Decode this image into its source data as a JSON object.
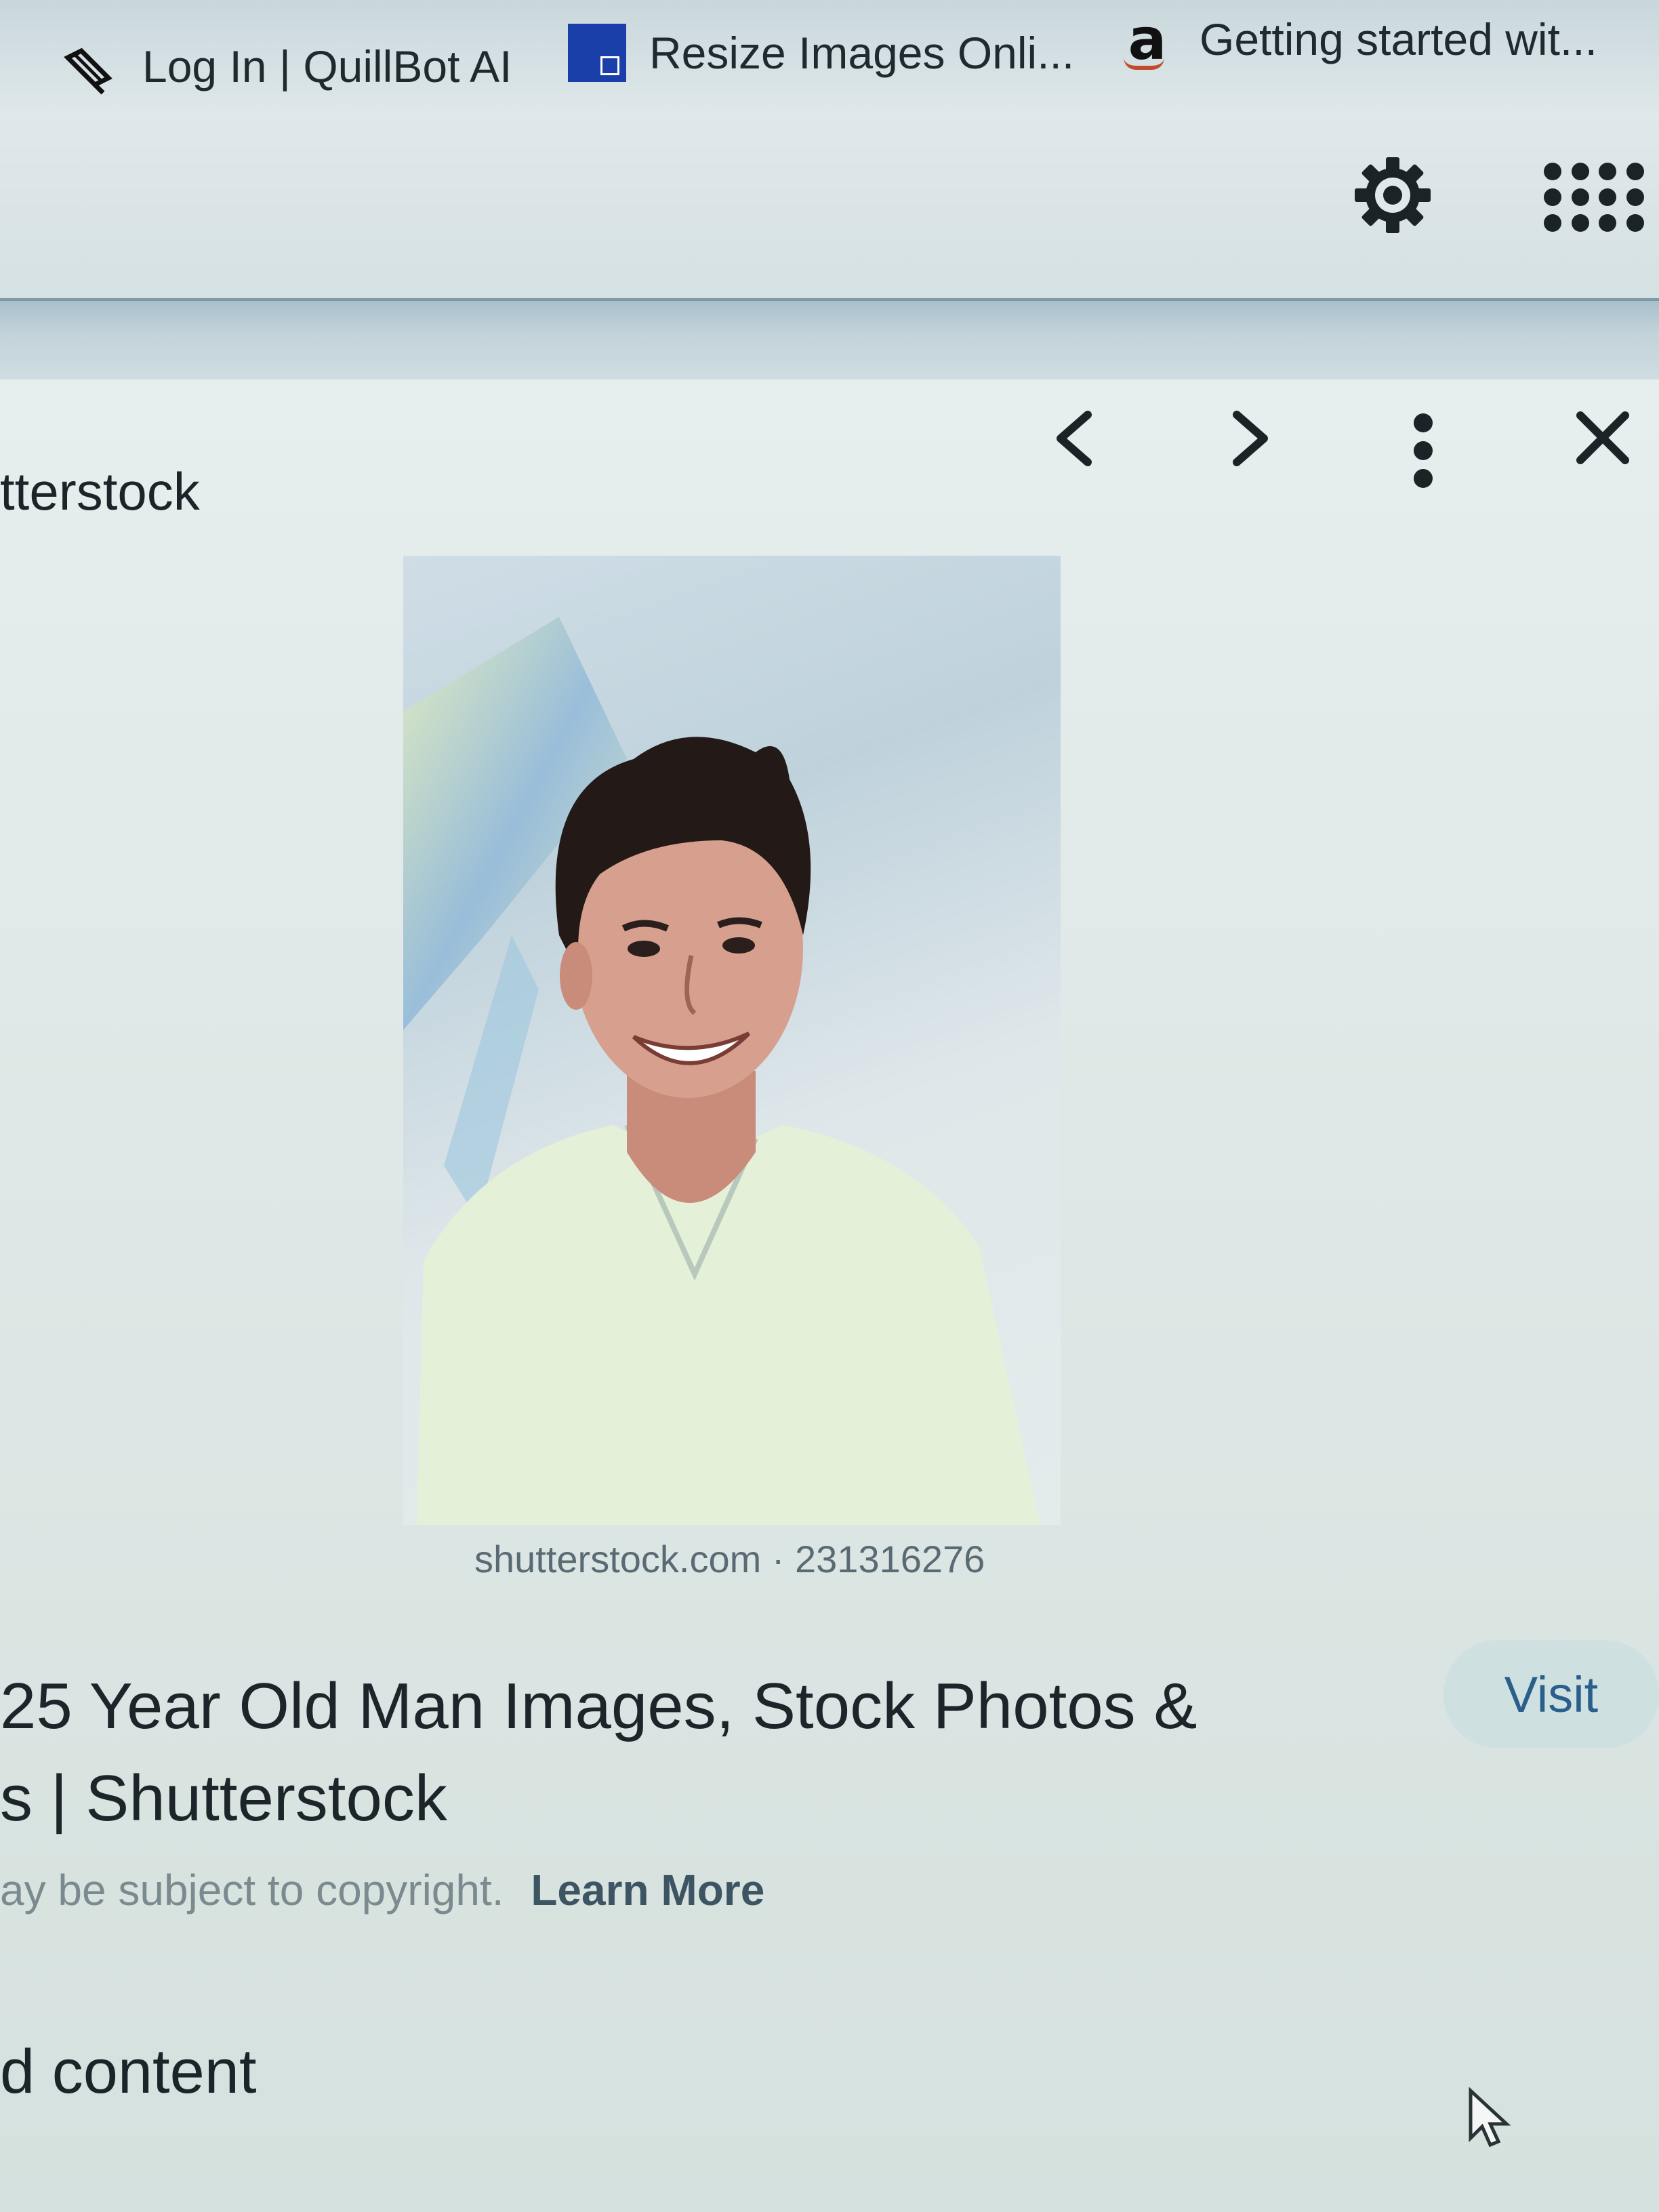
{
  "bookmarks": {
    "quillbot": "Log In | QuillBot AI",
    "resize": "Resize Images Onli...",
    "amazon": "Getting started wit..."
  },
  "viewer": {
    "source_title": "tterstock",
    "image_caption": "shutterstock.com · 231316276",
    "result_title": "25 Year Old Man Images, Stock Photos & s | Shutterstock",
    "visit_label": "Visit",
    "copyright_text": "ay be subject to copyright.",
    "learn_more_label": "Learn More",
    "related_label": "d content"
  },
  "colors": {
    "link": "#2a5f8c",
    "icon": "#1b2326"
  }
}
